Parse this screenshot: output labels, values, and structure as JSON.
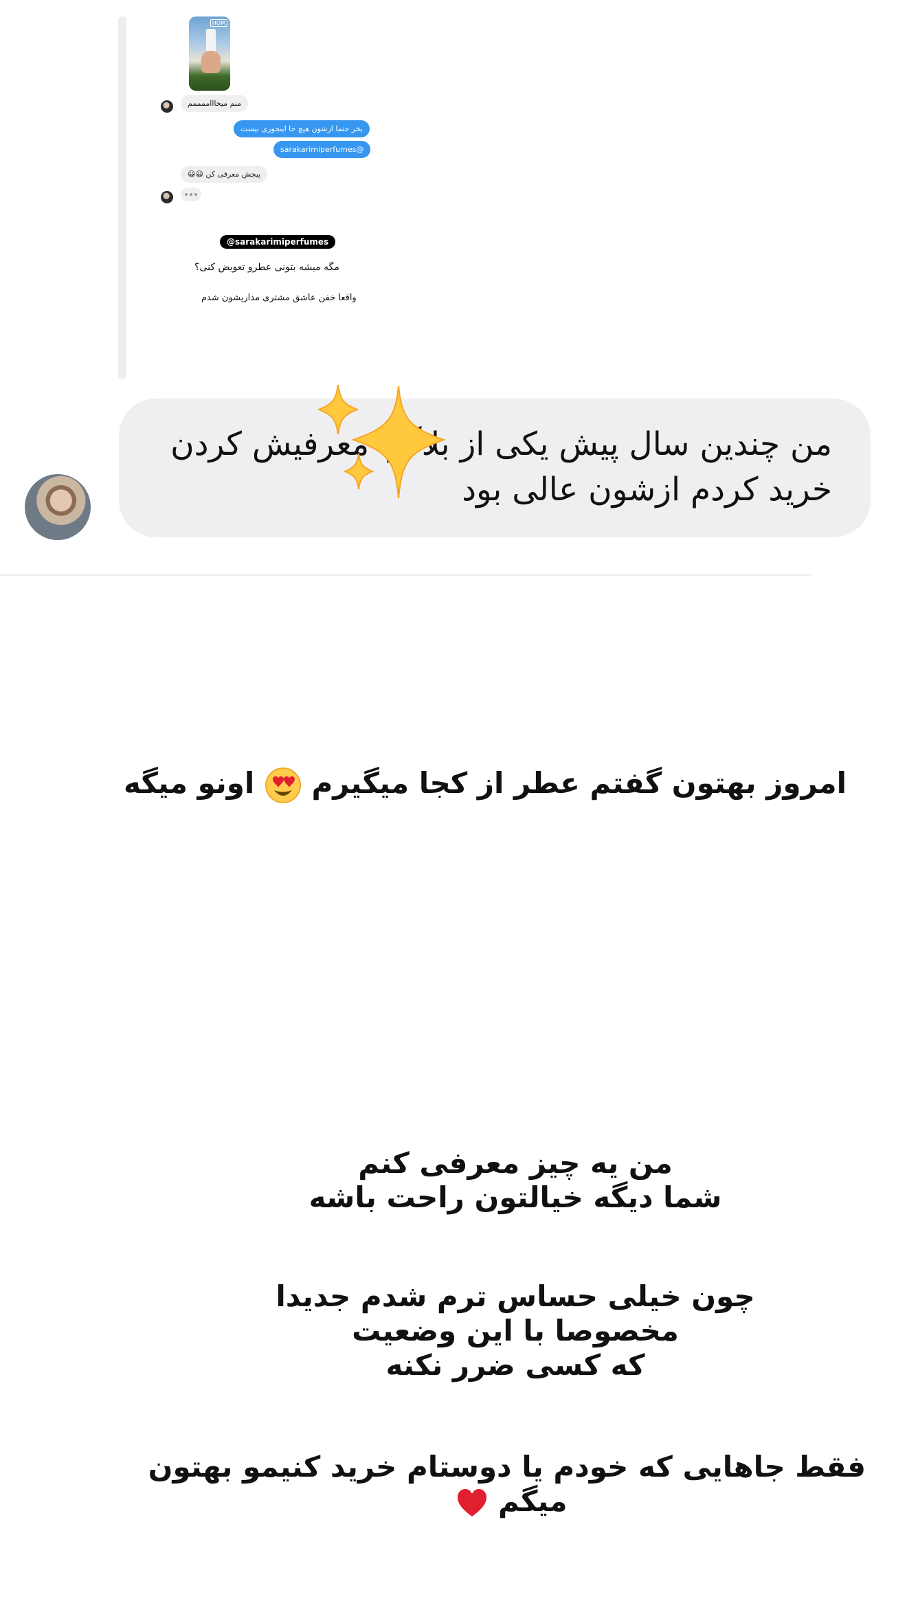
{
  "shared_post": {
    "thumbnail_label": "HOM",
    "messages": [
      {
        "side": "left",
        "text": "منم میخاااممممم"
      },
      {
        "side": "right",
        "text": "بخر حتما ازشون هیچ جا اینجوری نیست"
      },
      {
        "side": "right",
        "text": "@sarakarimiperfumes"
      },
      {
        "side": "left",
        "text": "پیجش معرفی کن 😃😃"
      }
    ],
    "tag": "@sarakarimiperfumes",
    "caption_1": "مگه میشه بتونی عطرو تعویض کنی؟",
    "caption_2": "واقعا خفن عاشق مشتری مداریشون شدم"
  },
  "comment": {
    "text": "من چندین سال پیش یکی از بلاگرا معرفیش کردن خرید کردم ازشون عالی بود"
  },
  "story": {
    "headline": "امروز بهتون گفتم عطر از کجا میگیرم",
    "headline_tail": "اونو میگه",
    "para1_line1": "من یه چیز معرفی کنم",
    "para1_line2": "شما دیگه خیالتون راحت باشه",
    "para2_line1": "چون خیلی حساس ترم شدم جدیدا",
    "para2_line2": "مخصوصا با این وضعیت",
    "para2_line3": "که کسی ضرر نکنه",
    "para3_line1": "فقط جاهایی که خودم یا دوستام خرید کنیمو بهتون",
    "para3_line2": "میگم"
  },
  "icons": {
    "sparkles": "sparkles-icon",
    "heart_eyes": "heart-eyes-emoji",
    "heart": "red-heart-emoji"
  },
  "colors": {
    "blue_bubble": "#3797f0",
    "grey_bubble": "#efeff1",
    "heart": "#e0202e",
    "sparkle": "#ffc83d"
  }
}
